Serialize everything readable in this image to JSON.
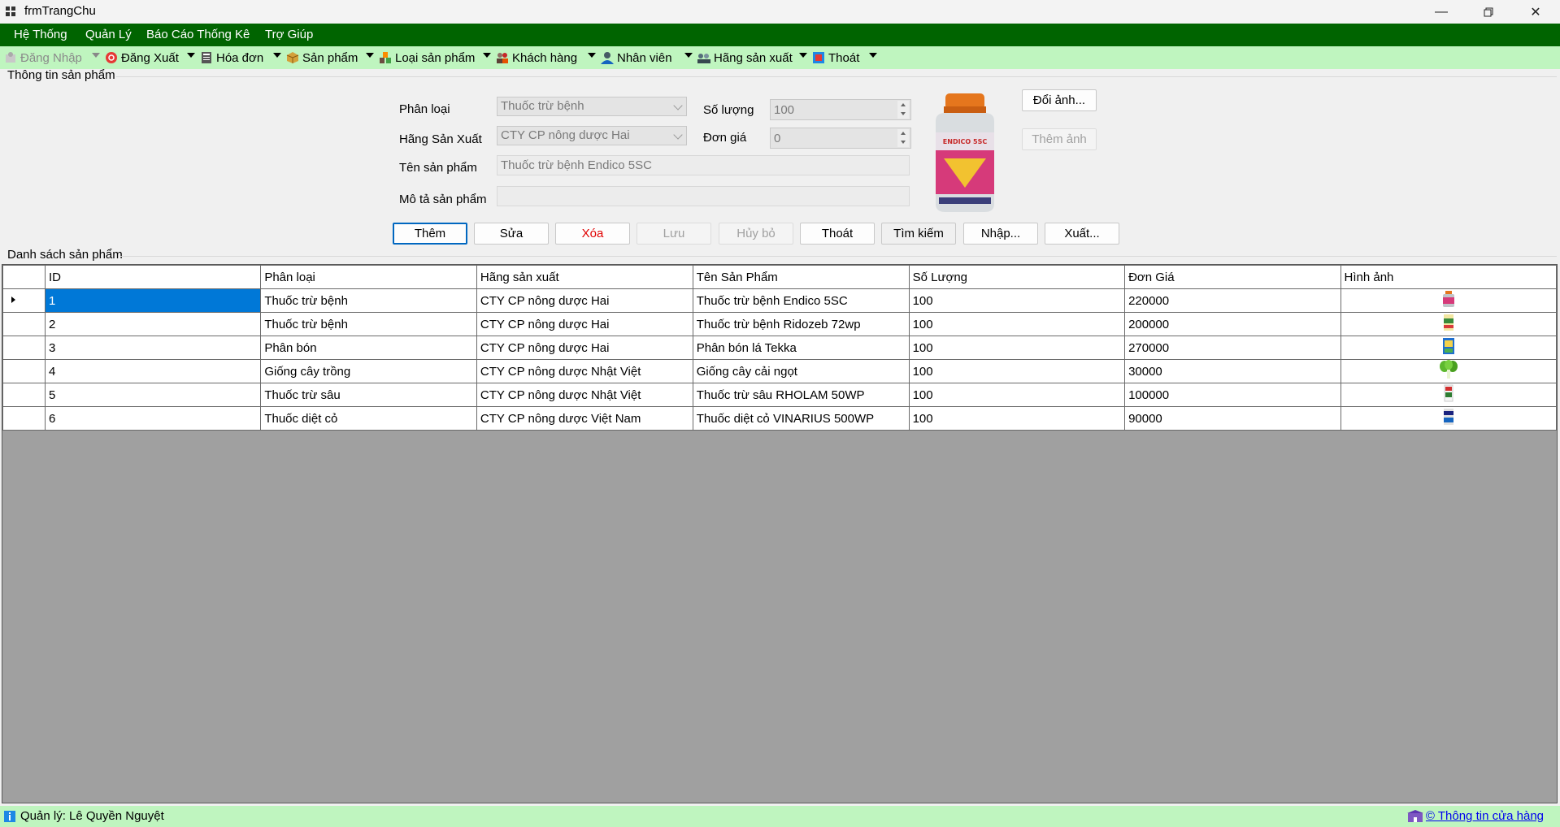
{
  "window": {
    "title": "frmTrangChu"
  },
  "menu": [
    "Hệ Thống",
    "Quản Lý",
    "Báo Cáo Thống Kê",
    "Trợ Giúp"
  ],
  "toolbar": {
    "dang_nhap": "Đăng Nhập",
    "dang_xuat": "Đăng Xuất",
    "hoa_don": "Hóa đơn",
    "san_pham": "Sản phẩm",
    "loai_san_pham": "Loại sản phẩm",
    "khach_hang": "Khách hàng",
    "nhan_vien": "Nhân viên",
    "hang_san_xuat": "Hãng sản xuất",
    "thoat": "Thoát"
  },
  "info": {
    "group_title": "Thông tin sản phẩm",
    "phan_loai_label": "Phân loại",
    "phan_loai_value": "Thuốc trừ bệnh",
    "hang_label": "Hãng Sản Xuất",
    "hang_value": "CTY CP nông dược Hai",
    "ten_label": "Tên sản phẩm",
    "ten_value": "Thuốc trừ bệnh Endico 5SC",
    "mota_label": "Mô tả sản phẩm",
    "mota_value": "",
    "soluong_label": "Số lượng",
    "soluong_value": "100",
    "dongia_label": "Đơn giá",
    "dongia_value": "0",
    "doi_anh": "Đổi ảnh...",
    "them_anh": "Thêm ảnh",
    "bottle_brand": "ENDICO 5SC"
  },
  "actions": {
    "them": "Thêm",
    "sua": "Sửa",
    "xoa": "Xóa",
    "luu": "Lưu",
    "huy_bo": "Hủy bỏ",
    "thoat": "Thoát",
    "tim_kiem": "Tìm kiếm",
    "nhap": "Nhập...",
    "xuat": "Xuất..."
  },
  "list": {
    "group_title": "Danh sách sản phẩm",
    "columns": [
      "ID",
      "Phân loại",
      "Hãng sản xuất",
      "Tên Sản Phẩm",
      "Số Lượng",
      "Đơn Giá",
      "Hình ảnh"
    ],
    "rows": [
      [
        "1",
        "Thuốc trừ bệnh",
        "CTY CP nông dược Hai",
        "Thuốc trừ bệnh Endico 5SC",
        "100",
        "220000"
      ],
      [
        "2",
        "Thuốc trừ bệnh",
        "CTY CP nông dược Hai",
        "Thuốc trừ bệnh Ridozeb 72wp",
        "100",
        "200000"
      ],
      [
        "3",
        "Phân bón",
        "CTY CP nông dược Hai",
        "Phân bón lá Tekka",
        "100",
        "270000"
      ],
      [
        "4",
        "Giống cây trồng",
        "CTY CP nông dược Nhật Việt",
        "Giống cây cải ngọt",
        "100",
        "30000"
      ],
      [
        "5",
        "Thuốc trừ sâu",
        "CTY CP nông dược Nhật Việt",
        "Thuốc trừ sâu RHOLAM 50WP",
        "100",
        "100000"
      ],
      [
        "6",
        "Thuốc diệt cỏ",
        "CTY CP nông dược Việt Nam",
        "Thuốc diệt cỏ VINARIUS 500WP",
        "100",
        "90000"
      ]
    ]
  },
  "status": {
    "left": "Quản lý: Lê Quyền Nguyệt",
    "right": "© Thông tin cửa hàng"
  },
  "colors": {
    "menubar": "#006400",
    "toolbar": "#bff5bf",
    "selection": "#0078d7",
    "grid_bg": "#a0a0a0"
  }
}
